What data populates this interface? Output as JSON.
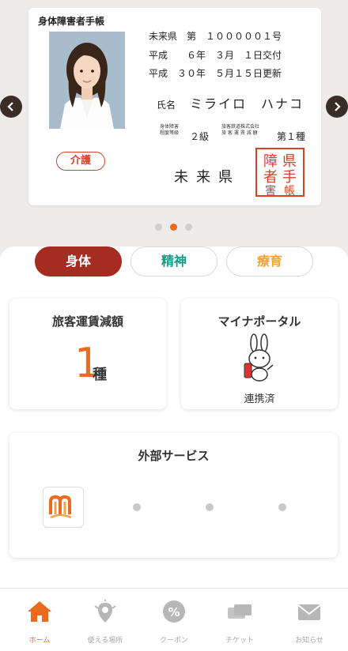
{
  "card": {
    "title": "身体障害者手帳",
    "number_line": "未来県　第　１０００００１号",
    "issue_line": "平成　　６年　３月　１日交付",
    "renew_line": "平成　３０年　５月１５日更新",
    "name_label": "氏名",
    "name_value": "ミライロ　ハナコ",
    "grade_label_1": "身体障害",
    "grade_label_2": "程度等級",
    "grade_value": "２級",
    "rail_label_1": "旅客鉄道株式会社",
    "rail_label_2": "旅 客 運 賃 減 額",
    "rail_value": "第１種",
    "care_badge": "介護",
    "prefecture": "未来県",
    "seal_chars": [
      "県",
      "手",
      "障",
      "帳",
      "者",
      "害"
    ]
  },
  "carousel": {
    "dots": 3,
    "active_index": 1
  },
  "tabs": [
    {
      "label": "身体",
      "color": "#ffffff",
      "active": true
    },
    {
      "label": "精神",
      "color": "#139a86",
      "active": false
    },
    {
      "label": "療育",
      "color": "#f0a33a",
      "active": false
    }
  ],
  "fare_panel": {
    "title": "旅客運賃減額",
    "number": "1",
    "unit": "種"
  },
  "portal_panel": {
    "title": "マイナポータル",
    "status": "連携済"
  },
  "services_panel": {
    "title": "外部サービス"
  },
  "bottom_nav": [
    {
      "label": "ホーム",
      "icon": "home-icon",
      "active": true
    },
    {
      "label": "使える場所",
      "icon": "map-pin-icon",
      "active": false
    },
    {
      "label": "クーポン",
      "icon": "coupon-icon",
      "active": false
    },
    {
      "label": "チケット",
      "icon": "ticket-icon",
      "active": false
    },
    {
      "label": "お知らせ",
      "icon": "mail-icon",
      "active": false
    }
  ],
  "colors": {
    "accent": "#ec6a1f",
    "brand_red": "#a62b21",
    "seal_red": "#d9402c"
  }
}
